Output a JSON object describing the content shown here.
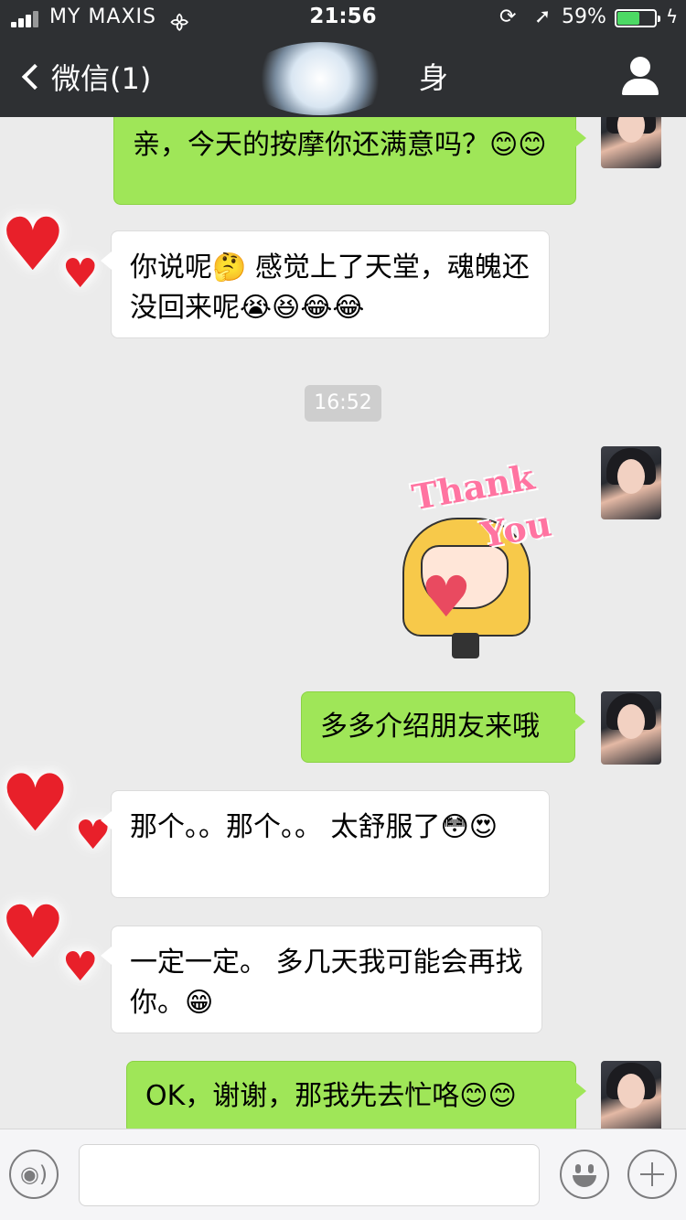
{
  "status_bar": {
    "carrier": "MY MAXIS",
    "time": "21:56",
    "battery_percent": "59%",
    "battery_level": 0.59,
    "wifi_icon": "wifi-icon",
    "rotation_lock_icon": "rotation-lock-icon",
    "location_icon": "location-arrow-icon",
    "charging_icon": "charging-bolt-icon"
  },
  "nav": {
    "back_label": "微信(1)",
    "title": "身",
    "profile_icon": "person-icon"
  },
  "messages": [
    {
      "side": "out",
      "text": "亲，今天的按摩你还满意吗？😊😊"
    },
    {
      "side": "in",
      "text": "你说呢🤔 感觉上了天堂，魂魄还没回来呢😭😆😂😂"
    },
    {
      "side": "time",
      "text": "16:52"
    },
    {
      "side": "out",
      "type": "sticker",
      "text_line1": "Thank",
      "text_line2": "You"
    },
    {
      "side": "out",
      "text": "多多介绍朋友来哦"
    },
    {
      "side": "in",
      "text": "那个。。那个。。 太舒服了😳😍"
    },
    {
      "side": "in",
      "text": "一定一定。 多几天我可能会再找你。😁"
    },
    {
      "side": "out",
      "text": "OK，谢谢，那我先去忙咯😊😊"
    }
  ],
  "input_bar": {
    "placeholder": "",
    "voice_icon": "voice-icon",
    "emoji_icon": "emoji-icon",
    "plus_icon": "plus-icon"
  },
  "colors": {
    "header_bg": "#2e3033",
    "chat_bg": "#ebebeb",
    "outgoing_bubble": "#9fe658",
    "incoming_bubble": "#ffffff",
    "battery_fill": "#4cd964"
  }
}
